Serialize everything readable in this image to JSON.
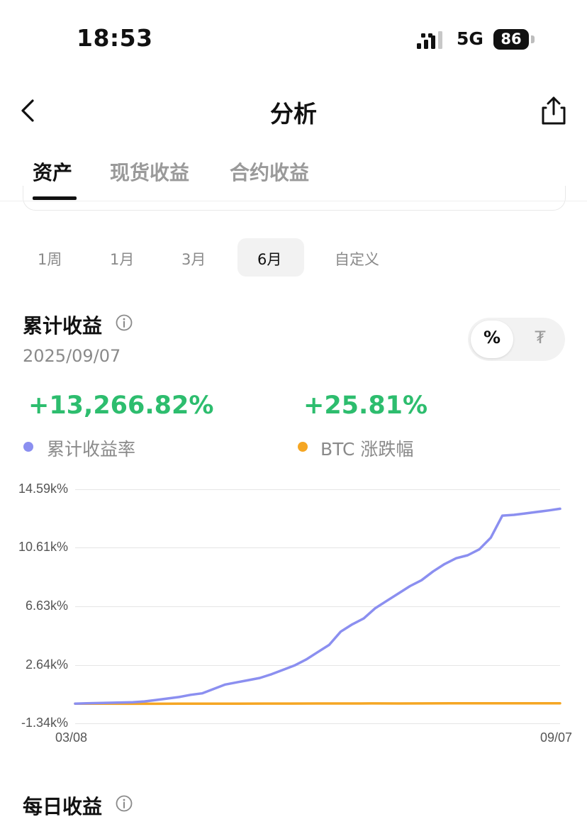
{
  "status_bar": {
    "time": "18:53",
    "network": "5G",
    "battery": "86"
  },
  "nav": {
    "title": "分析"
  },
  "tabs": [
    "资产",
    "现货收益",
    "合约收益"
  ],
  "ranges": [
    "1周",
    "1月",
    "3月",
    "6月",
    "自定义"
  ],
  "selected_range": "6月",
  "cumulative": {
    "title": "累计收益",
    "date": "2025/09/07",
    "toggle": {
      "percent": "%",
      "currency": "₮"
    },
    "value_rate": "+13,266.82%",
    "value_btc": "+25.81%",
    "legend_rate": "累计收益率",
    "legend_btc": "BTC 涨跌幅"
  },
  "daily": {
    "title": "每日收益"
  },
  "colors": {
    "rate": "#8b8ff0",
    "btc": "#f5a623",
    "positive": "#2dbd6e"
  },
  "chart_data": {
    "type": "line",
    "y_ticks": [
      "14.59k%",
      "10.61k%",
      "6.63k%",
      "2.64k%",
      "-1.34k%"
    ],
    "y_tick_values": [
      14590,
      10610,
      6630,
      2640,
      -1340
    ],
    "x_ticks": [
      "03/08",
      "09/07"
    ],
    "ylim": [
      -1340,
      14590
    ],
    "grid": true,
    "series": [
      {
        "name": "累计收益率",
        "color": "#8b8ff0",
        "values": [
          0,
          20,
          40,
          60,
          80,
          100,
          150,
          250,
          350,
          450,
          600,
          700,
          1000,
          1300,
          1450,
          1600,
          1750,
          2000,
          2300,
          2600,
          3000,
          3500,
          4000,
          4900,
          5400,
          5800,
          6500,
          7000,
          7500,
          8000,
          8400,
          9000,
          9500,
          9900,
          10100,
          10500,
          11300,
          12800,
          12850,
          12950,
          13050,
          13150,
          13266.82
        ]
      },
      {
        "name": "BTC 涨跌幅",
        "color": "#f5a623",
        "values": [
          0,
          -5,
          -10,
          -8,
          -3,
          0,
          2,
          5,
          8,
          10,
          12,
          15,
          14,
          18,
          20,
          22,
          24,
          25,
          25.81
        ]
      }
    ]
  }
}
